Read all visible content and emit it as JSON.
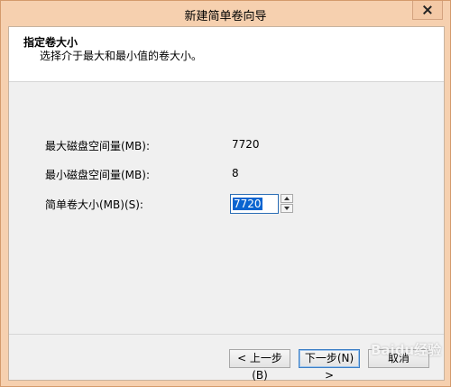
{
  "window": {
    "title": "新建简单卷向导"
  },
  "header": {
    "title": "指定卷大小",
    "subtitle": "选择介于最大和最小值的卷大小。"
  },
  "fields": {
    "max_label": "最大磁盘空间量(MB):",
    "max_value": "7720",
    "min_label": "最小磁盘空间量(MB):",
    "min_value": "8",
    "size_label": "简单卷大小(MB)(S):",
    "size_value": "7720"
  },
  "buttons": {
    "back": "< 上一步(B)",
    "next": "下一步(N) >",
    "cancel": "取消"
  },
  "watermark": "Baidu经验"
}
